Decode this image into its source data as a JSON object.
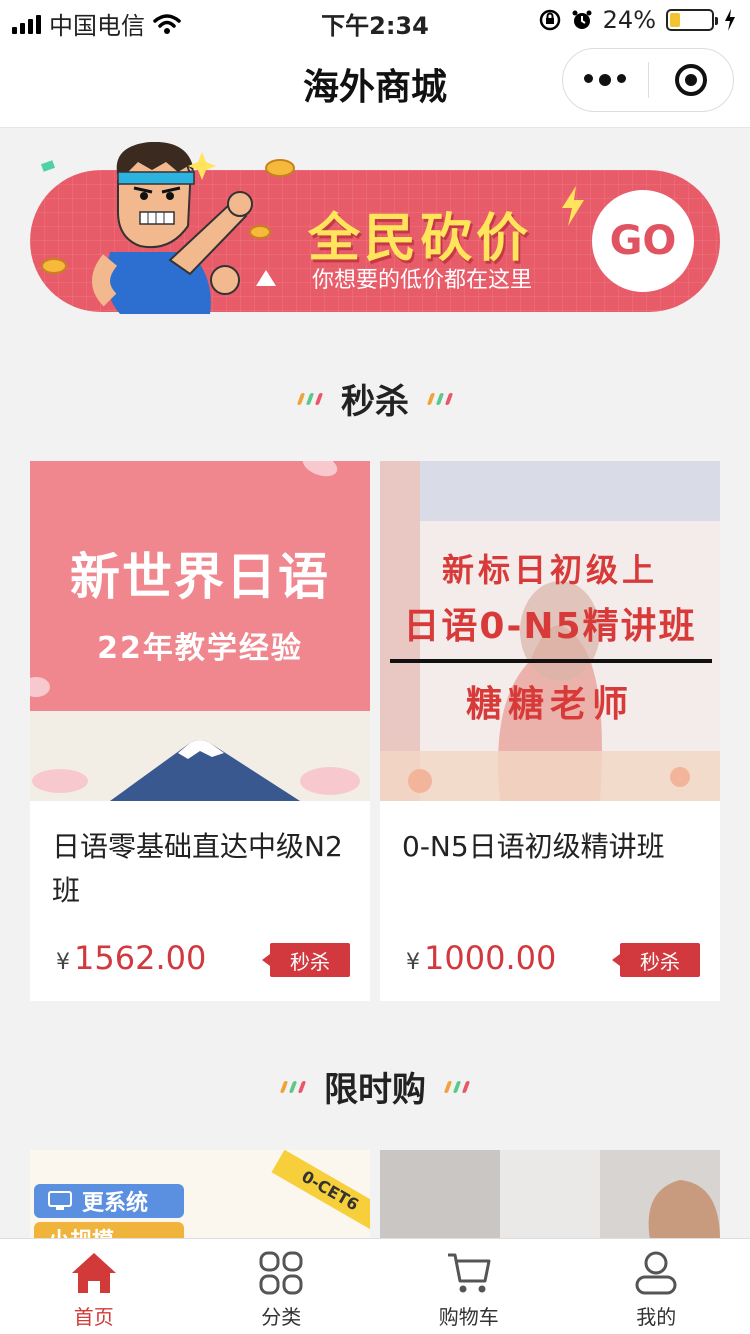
{
  "status_bar": {
    "carrier": "中国电信",
    "time": "下午2:34",
    "battery": "24%",
    "battery_level": 0.24
  },
  "nav": {
    "title": "海外商城"
  },
  "banner": {
    "title": "全民砍价",
    "subtitle": "你想要的低价都在这里",
    "go_label": "GO"
  },
  "sections": {
    "seckill": "秒杀",
    "limited": "限时购"
  },
  "products": [
    {
      "image_title": "新世界日语",
      "image_subtitle": "22年教学经验",
      "name": "日语零基础直达中级N2班",
      "currency": "¥",
      "price": "1562.00",
      "tag": "秒杀"
    },
    {
      "image_line1": "新标日初级上",
      "image_line2": "日语0-N5精讲班",
      "image_line3": "糖糖老师",
      "name": "0-N5日语初级精讲班",
      "currency": "¥",
      "price": "1000.00",
      "tag": "秒杀"
    }
  ],
  "limited_preview": {
    "pill1": "更系统",
    "pill2": "小规模",
    "corner_tag": "0-CET6"
  },
  "tabbar": [
    {
      "label": "首页",
      "icon": "home-icon",
      "active": true
    },
    {
      "label": "分类",
      "icon": "category-icon",
      "active": false
    },
    {
      "label": "购物车",
      "icon": "cart-icon",
      "active": false
    },
    {
      "label": "我的",
      "icon": "user-icon",
      "active": false
    }
  ],
  "colors": {
    "accent": "#d1393f",
    "banner_bg": "#e85b68",
    "banner_title": "#ffe45c"
  }
}
